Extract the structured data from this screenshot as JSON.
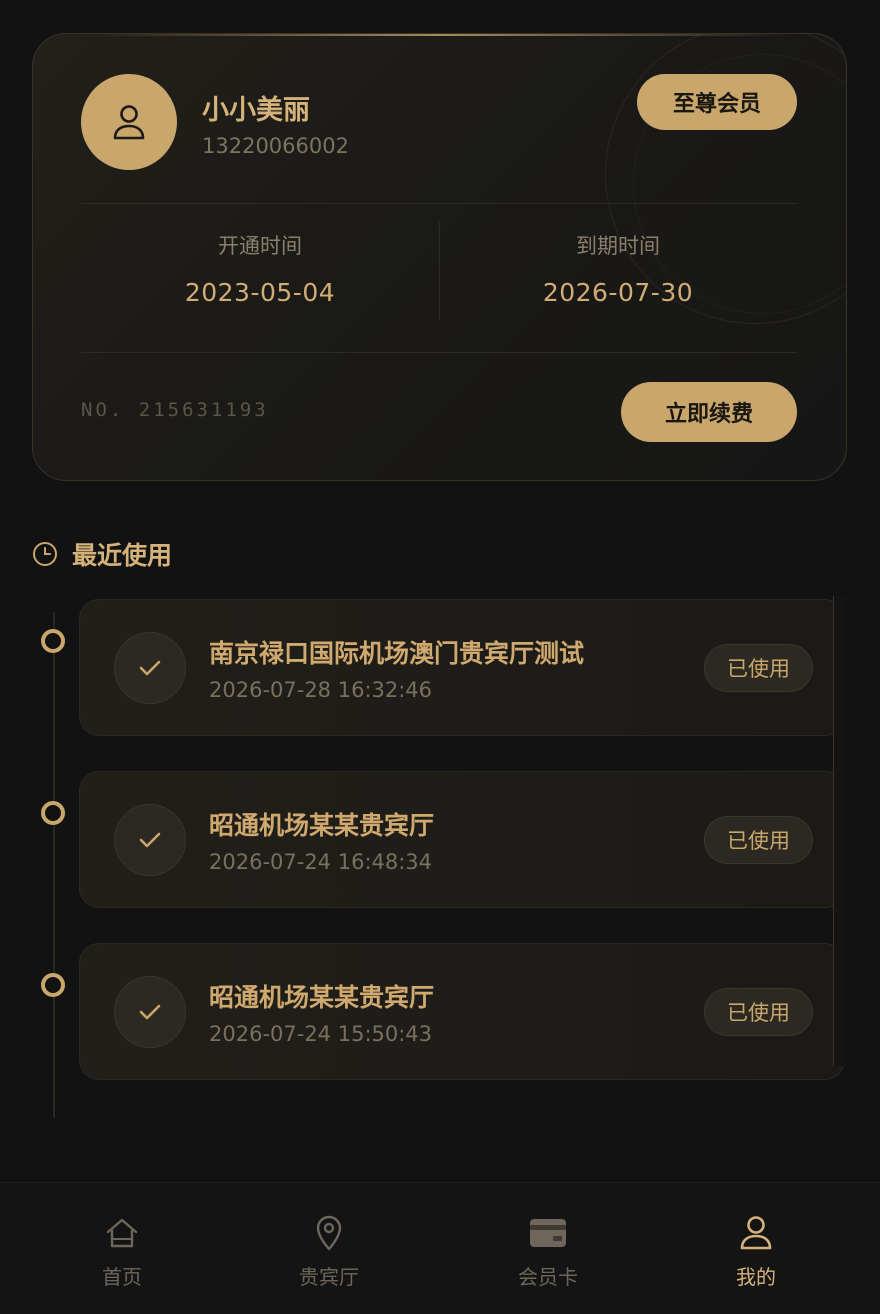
{
  "profile": {
    "name": "小小美丽",
    "phone": "13220066002",
    "tier_label": "至尊会员",
    "open_label": "开通时间",
    "open_date": "2023-05-04",
    "expire_label": "到期时间",
    "expire_date": "2026-07-30",
    "card_no": "NO. 215631193",
    "renew_label": "立即续费"
  },
  "recent": {
    "title": "最近使用",
    "items": [
      {
        "name": "南京禄口国际机场澳门贵宾厅测试",
        "time": "2026-07-28 16:32:46",
        "status": "已使用"
      },
      {
        "name": "昭通机场某某贵宾厅",
        "time": "2026-07-24 16:48:34",
        "status": "已使用"
      },
      {
        "name": "昭通机场某某贵宾厅",
        "time": "2026-07-24 15:50:43",
        "status": "已使用"
      }
    ]
  },
  "nav": {
    "items": [
      {
        "label": "首页",
        "icon": "home-icon"
      },
      {
        "label": "贵宾厅",
        "icon": "location-pin-icon"
      },
      {
        "label": "会员卡",
        "icon": "card-icon"
      },
      {
        "label": "我的",
        "icon": "user-icon",
        "active": true
      }
    ]
  },
  "colors": {
    "accent": "#c9a66b",
    "background": "#121212"
  }
}
